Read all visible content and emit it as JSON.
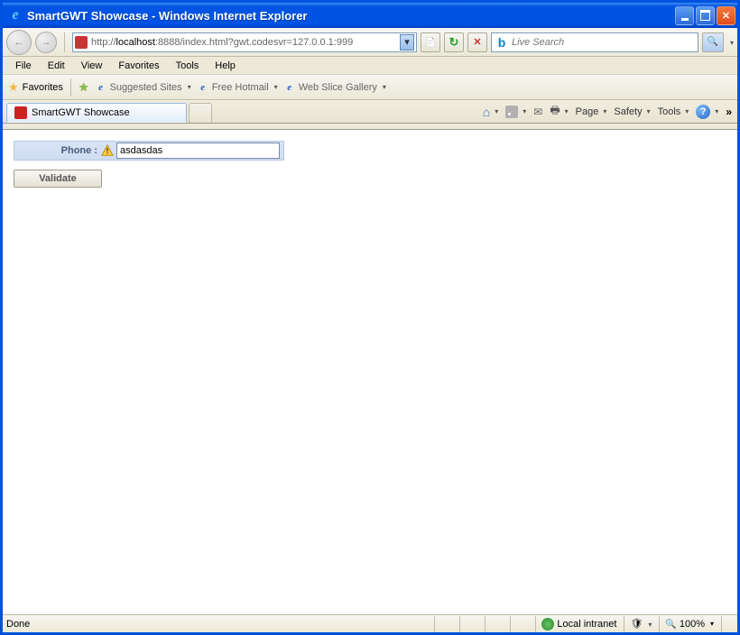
{
  "window": {
    "title": "SmartGWT Showcase - Windows Internet Explorer"
  },
  "nav": {
    "url_prefix": "http://",
    "url_host": "localhost",
    "url_suffix": ":8888/index.html?gwt.codesvr=127.0.0.1:999",
    "search_placeholder": "Live Search"
  },
  "menus": [
    "File",
    "Edit",
    "View",
    "Favorites",
    "Tools",
    "Help"
  ],
  "favbar": {
    "label": "Favorites",
    "links": [
      "Suggested Sites",
      "Free Hotmail",
      "Web Slice Gallery"
    ]
  },
  "tabs": [
    {
      "title": "SmartGWT Showcase"
    }
  ],
  "tabtools": [
    "Page",
    "Safety",
    "Tools"
  ],
  "form": {
    "phone_label": "Phone :",
    "phone_value": "asdasdas",
    "validate_label": "Validate"
  },
  "status": {
    "text": "Done",
    "zone": "Local intranet",
    "zoom": "100%"
  }
}
